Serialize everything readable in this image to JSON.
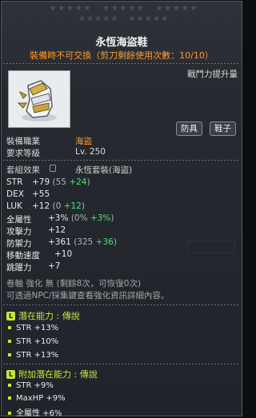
{
  "title": "永恆海盜鞋",
  "subtitle": "裝備時不可交換（剪刀剩餘使用次數：10/10）",
  "power_label": "戰鬥力提升量",
  "tags": [
    "防具",
    "鞋子"
  ],
  "requirements": [
    {
      "label": "裝備職業",
      "value": "海盜"
    },
    {
      "label": "要求等級",
      "value": "Lv. 250"
    }
  ],
  "set": {
    "label": "套組效果",
    "name": "永恆套裝(海盜)"
  },
  "stats": [
    {
      "name": "STR",
      "total": "+79",
      "base": "(55",
      "bonus": "+24",
      "end": ")"
    },
    {
      "name": "DEX",
      "total": "+55",
      "base": "",
      "bonus": "",
      "end": ""
    },
    {
      "name": "LUK",
      "total": "+12",
      "base": "(0",
      "bonus": "+12",
      "end": ")"
    },
    {
      "name": "全屬性",
      "total": "+3%",
      "base": "(0%",
      "bonus": "+3%",
      "end": ")"
    },
    {
      "name": "攻擊力",
      "total": "+12",
      "base": "",
      "bonus": "",
      "end": ""
    },
    {
      "name": "防禦力",
      "total": "+361",
      "base": "(325",
      "bonus": "+36",
      "end": ")"
    },
    {
      "name": "移動速度",
      "total": "+10",
      "base": "",
      "bonus": "",
      "end": ""
    },
    {
      "name": "跳躍力",
      "total": "+7",
      "base": "",
      "bonus": "",
      "end": ""
    }
  ],
  "scroll_info": "卷軸 強化 無 (剩餘8次，可恢復0次)",
  "npc_info": "可透過NPC/採集鍵查看強化資訊詳細內容。",
  "potential": {
    "icon": "L",
    "label": "潛在能力 : 傳說",
    "color": "#c8e63a",
    "lines": [
      "STR +13%",
      "STR +10%",
      "STR +13%"
    ]
  },
  "additional": {
    "icon": "L",
    "label": "附加潛在能力 : 傳說",
    "color": "#c8e63a",
    "lines": [
      "STR +9%",
      "MaxHP +9%",
      "全屬性 +6%"
    ]
  }
}
